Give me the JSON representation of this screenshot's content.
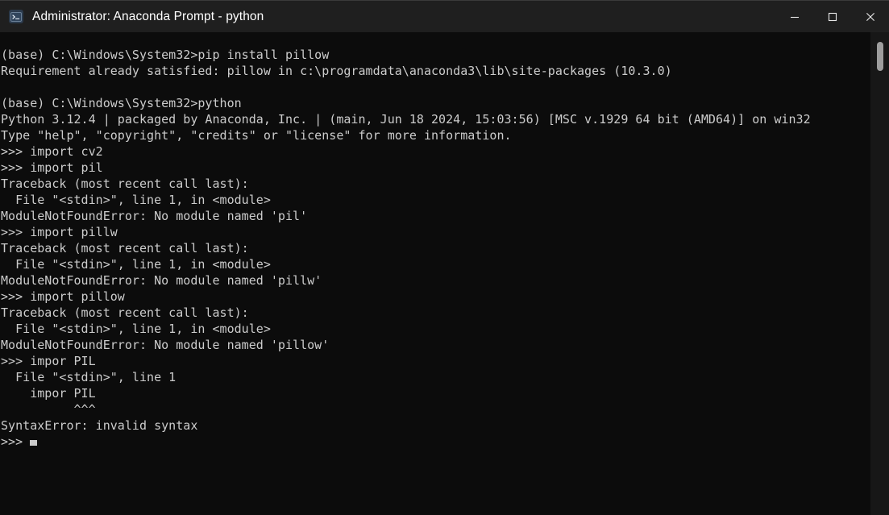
{
  "window": {
    "title": "Administrator: Anaconda Prompt - python",
    "icon": "terminal-prompt-icon",
    "background_color": "#0c0c0c",
    "titlebar_color": "#1f1f1f",
    "text_color": "#cccccc"
  },
  "window_controls": {
    "minimize_label": "Minimize",
    "maximize_label": "Maximize",
    "close_label": "Close"
  },
  "scrollbar": {
    "thumb_position_percent": 2,
    "thumb_size_percent": 6
  },
  "terminal": {
    "prompt_symbol": ">>>",
    "shell_prompt": "(base) C:\\Windows\\System32>",
    "cursor_visible": true,
    "lines": [
      "(base) C:\\Windows\\System32>pip install pillow",
      "Requirement already satisfied: pillow in c:\\programdata\\anaconda3\\lib\\site-packages (10.3.0)",
      "",
      "(base) C:\\Windows\\System32>python",
      "Python 3.12.4 | packaged by Anaconda, Inc. | (main, Jun 18 2024, 15:03:56) [MSC v.1929 64 bit (AMD64)] on win32",
      "Type \"help\", \"copyright\", \"credits\" or \"license\" for more information.",
      ">>> import cv2",
      ">>> import pil",
      "Traceback (most recent call last):",
      "  File \"<stdin>\", line 1, in <module>",
      "ModuleNotFoundError: No module named 'pil'",
      ">>> import pillw",
      "Traceback (most recent call last):",
      "  File \"<stdin>\", line 1, in <module>",
      "ModuleNotFoundError: No module named 'pillw'",
      ">>> import pillow",
      "Traceback (most recent call last):",
      "  File \"<stdin>\", line 1, in <module>",
      "ModuleNotFoundError: No module named 'pillow'",
      ">>> impor PIL",
      "  File \"<stdin>\", line 1",
      "    impor PIL",
      "          ^^^",
      "SyntaxError: invalid syntax"
    ],
    "last_prompt": ">>> "
  }
}
